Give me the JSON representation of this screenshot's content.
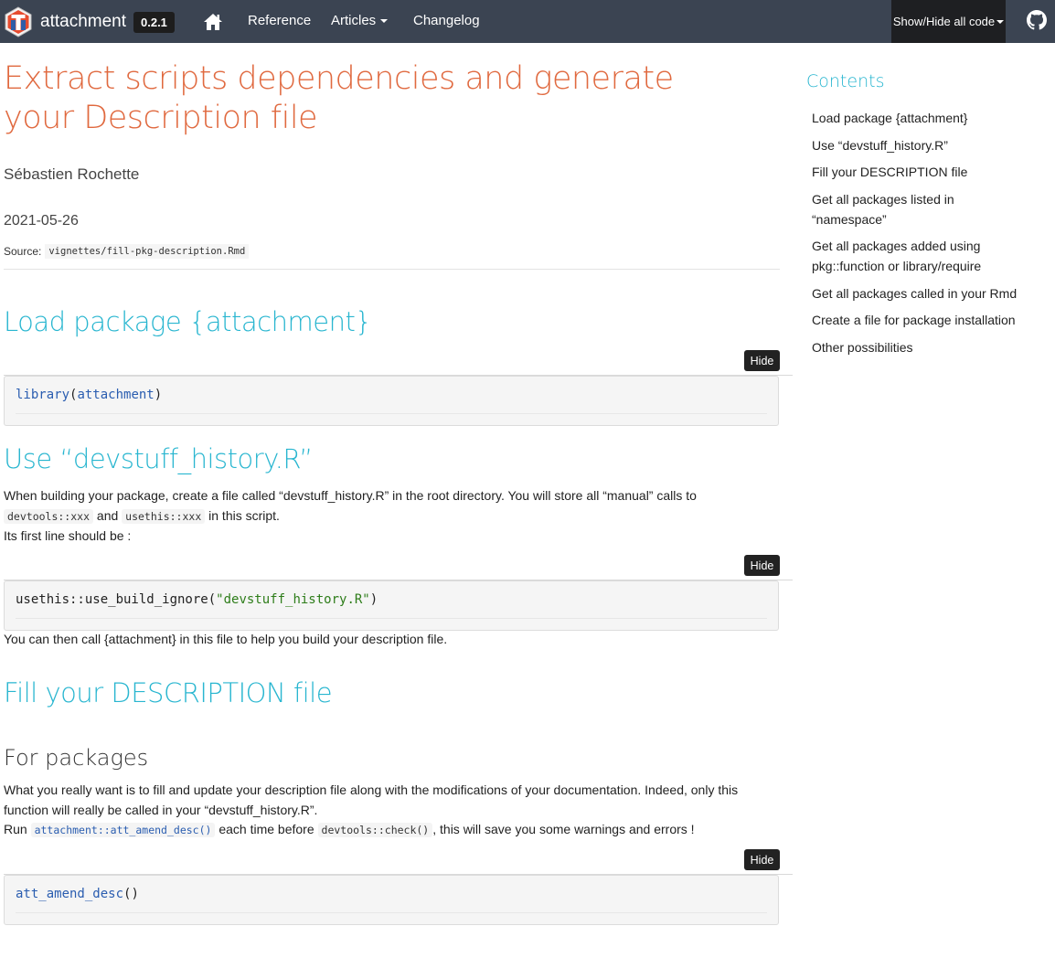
{
  "navbar": {
    "brand": "attachment",
    "version": "0.2.1",
    "links": [
      {
        "label": "Reference",
        "dropdown": false
      },
      {
        "label": "Articles",
        "dropdown": true
      },
      {
        "label": "Changelog",
        "dropdown": false
      }
    ],
    "show_hide": "Show/Hide all code",
    "colors": {
      "bg": "#3b4452",
      "accent_dark": "#1e1f22"
    }
  },
  "article": {
    "title": "Extract scripts dependencies and generate your Description file",
    "author": "Sébastien Rochette",
    "date": "2021-05-26",
    "source_label": "Source:",
    "source_path": "vignettes/fill-pkg-description.Rmd"
  },
  "sections": {
    "load": {
      "heading": "Load package {attachment}",
      "hide_label": "Hide",
      "code_fn": "library",
      "code_paren_open": "(",
      "code_arg": "attachment",
      "code_paren_close": ")"
    },
    "devstuff": {
      "heading": "Use “devstuff_history.R”",
      "p1": "When building your package, create a file called “devstuff_history.R” in the root directory. You will store all “manual” calls to",
      "code1": "devtools::xxx",
      "and": "and",
      "code2": "usethis::xxx",
      "p1_end": "in this script.",
      "p2": "Its first line should be :",
      "hide_label": "Hide",
      "code_fn": "usethis::use_build_ignore(",
      "code_str": "\"devstuff_history.R\"",
      "code_close": ")",
      "after": "You can then call {attachment} in this file to help you build your description file."
    },
    "fill": {
      "heading": "Fill your DESCRIPTION file",
      "subheading": "For packages",
      "p1": "What you really want is to fill and update your description file along with the modifications of your documentation. Indeed, only this function will really be called in your “devstuff_history.R”.",
      "run": "Run",
      "code1": "attachment::att_amend_desc()",
      "mid": "each time before",
      "code2": "devtools::check()",
      "end": ", this will save you some warnings and errors !",
      "hide_label": "Hide",
      "code_fn": "att_amend_desc",
      "code_paren": "()"
    }
  },
  "toc": {
    "title": "Contents",
    "items": [
      "Load package {attachment}",
      "Use “devstuff_history.R”",
      "Fill your DESCRIPTION file",
      "Get all packages listed in “namespace”",
      "Get all packages added using pkg::function or library/require",
      "Get all packages called in your Rmd",
      "Create a file for package installation",
      "Other possibilities"
    ]
  },
  "icons": [
    "logo-icon",
    "home-icon",
    "caret-down-icon",
    "github-icon"
  ],
  "colors": {
    "title": "#e0693f",
    "heading": "#29b6d0",
    "code_fn": "#2a5db0",
    "code_str": "#2e7d1a"
  }
}
